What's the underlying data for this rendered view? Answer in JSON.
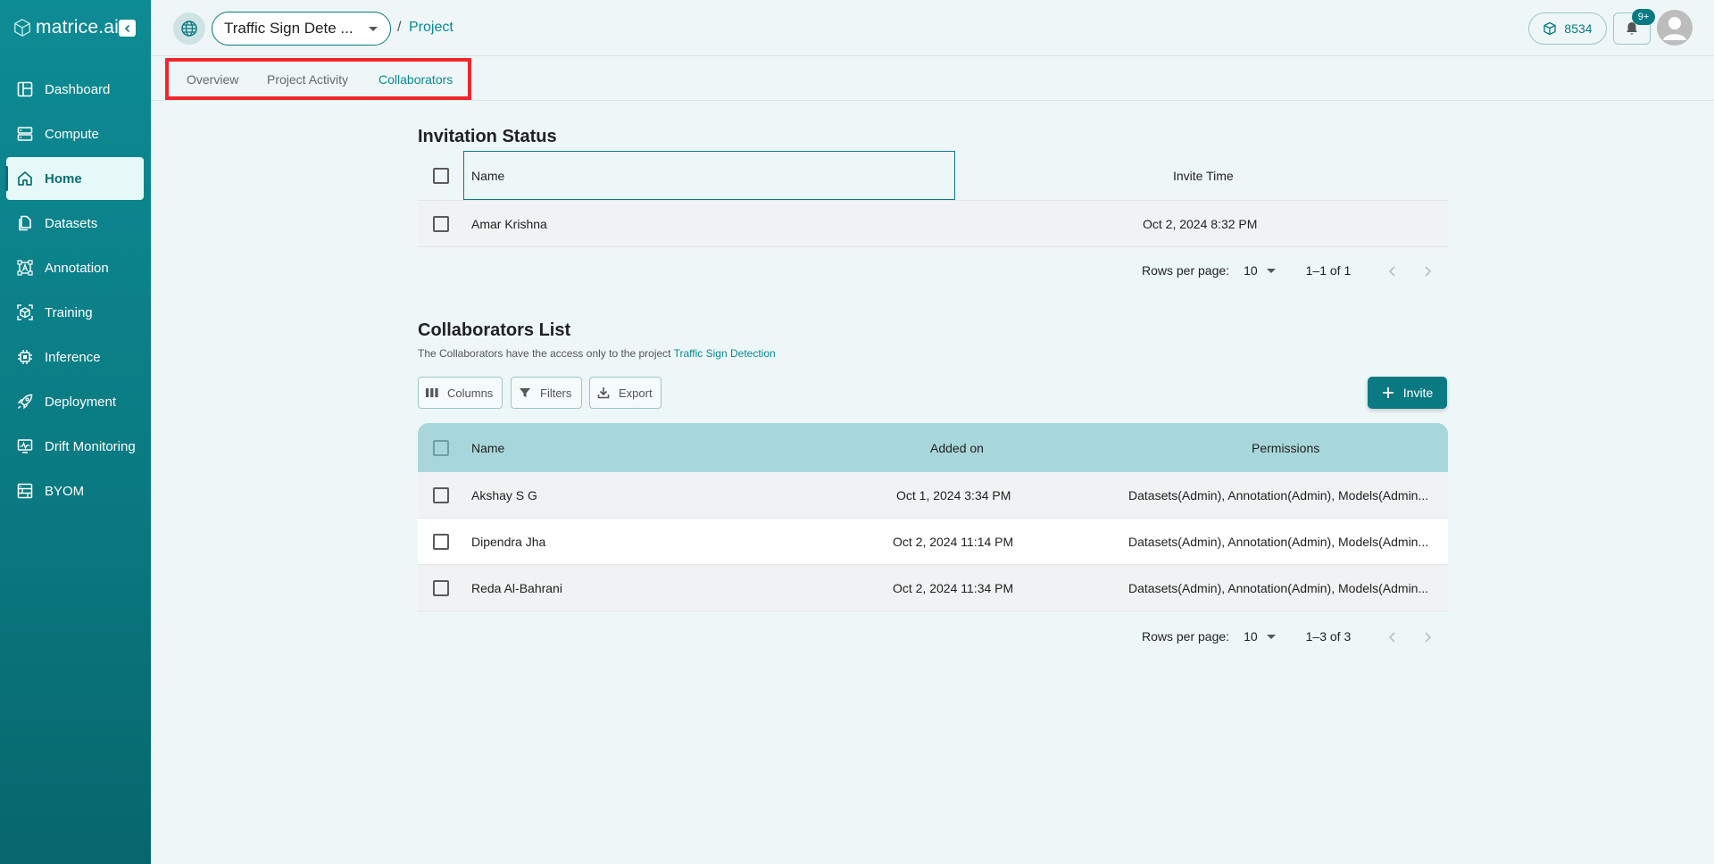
{
  "brand": {
    "name": "matrice.ai"
  },
  "sidebar": {
    "items": [
      {
        "label": "Dashboard",
        "icon": "dashboard-icon"
      },
      {
        "label": "Compute",
        "icon": "server-icon"
      },
      {
        "label": "Home",
        "icon": "home-icon",
        "active": true
      },
      {
        "label": "Datasets",
        "icon": "files-icon"
      },
      {
        "label": "Annotation",
        "icon": "annotation-icon"
      },
      {
        "label": "Training",
        "icon": "cube-icon"
      },
      {
        "label": "Inference",
        "icon": "chip-icon"
      },
      {
        "label": "Deployment",
        "icon": "rocket-icon"
      },
      {
        "label": "Drift Monitoring",
        "icon": "monitor-icon"
      },
      {
        "label": "BYOM",
        "icon": "byom-icon"
      }
    ]
  },
  "header": {
    "project_select": "Traffic Sign Dete ...",
    "breadcrumb_sep": "/",
    "breadcrumb_link": "Project",
    "credits": "8534",
    "notifications_badge": "9+"
  },
  "tabs": [
    {
      "label": "Overview"
    },
    {
      "label": "Project Activity"
    },
    {
      "label": "Collaborators",
      "active": true
    }
  ],
  "invitation": {
    "title": "Invitation Status",
    "columns": {
      "name": "Name",
      "invite_time": "Invite Time"
    },
    "rows": [
      {
        "name": "Amar Krishna",
        "time": "Oct 2, 2024 8:32 PM"
      }
    ],
    "pagination": {
      "rows_label": "Rows per page:",
      "rows_value": "10",
      "range": "1–1 of 1"
    }
  },
  "collaborators": {
    "title": "Collaborators List",
    "subtitle": "The Collaborators have the access only to the project",
    "project_link": "Traffic Sign Detection",
    "toolbar": {
      "columns": "Columns",
      "filters": "Filters",
      "export": "Export",
      "invite": "Invite"
    },
    "columns": {
      "name": "Name",
      "added_on": "Added on",
      "permissions": "Permissions"
    },
    "rows": [
      {
        "name": "Akshay S G",
        "added": "Oct 1, 2024 3:34 PM",
        "permissions": "Datasets(Admin), Annotation(Admin), Models(Admin..."
      },
      {
        "name": "Dipendra Jha",
        "added": "Oct 2, 2024 11:14 PM",
        "permissions": "Datasets(Admin), Annotation(Admin), Models(Admin..."
      },
      {
        "name": "Reda Al-Bahrani",
        "added": "Oct 2, 2024 11:34 PM",
        "permissions": "Datasets(Admin), Annotation(Admin), Models(Admin..."
      }
    ],
    "pagination": {
      "rows_label": "Rows per page:",
      "rows_value": "10",
      "range": "1–3 of 3"
    }
  },
  "colors": {
    "primary": "#0a7a82",
    "accent": "#0a8891",
    "header_row": "#a8d7db",
    "highlight": "#f0262c"
  }
}
